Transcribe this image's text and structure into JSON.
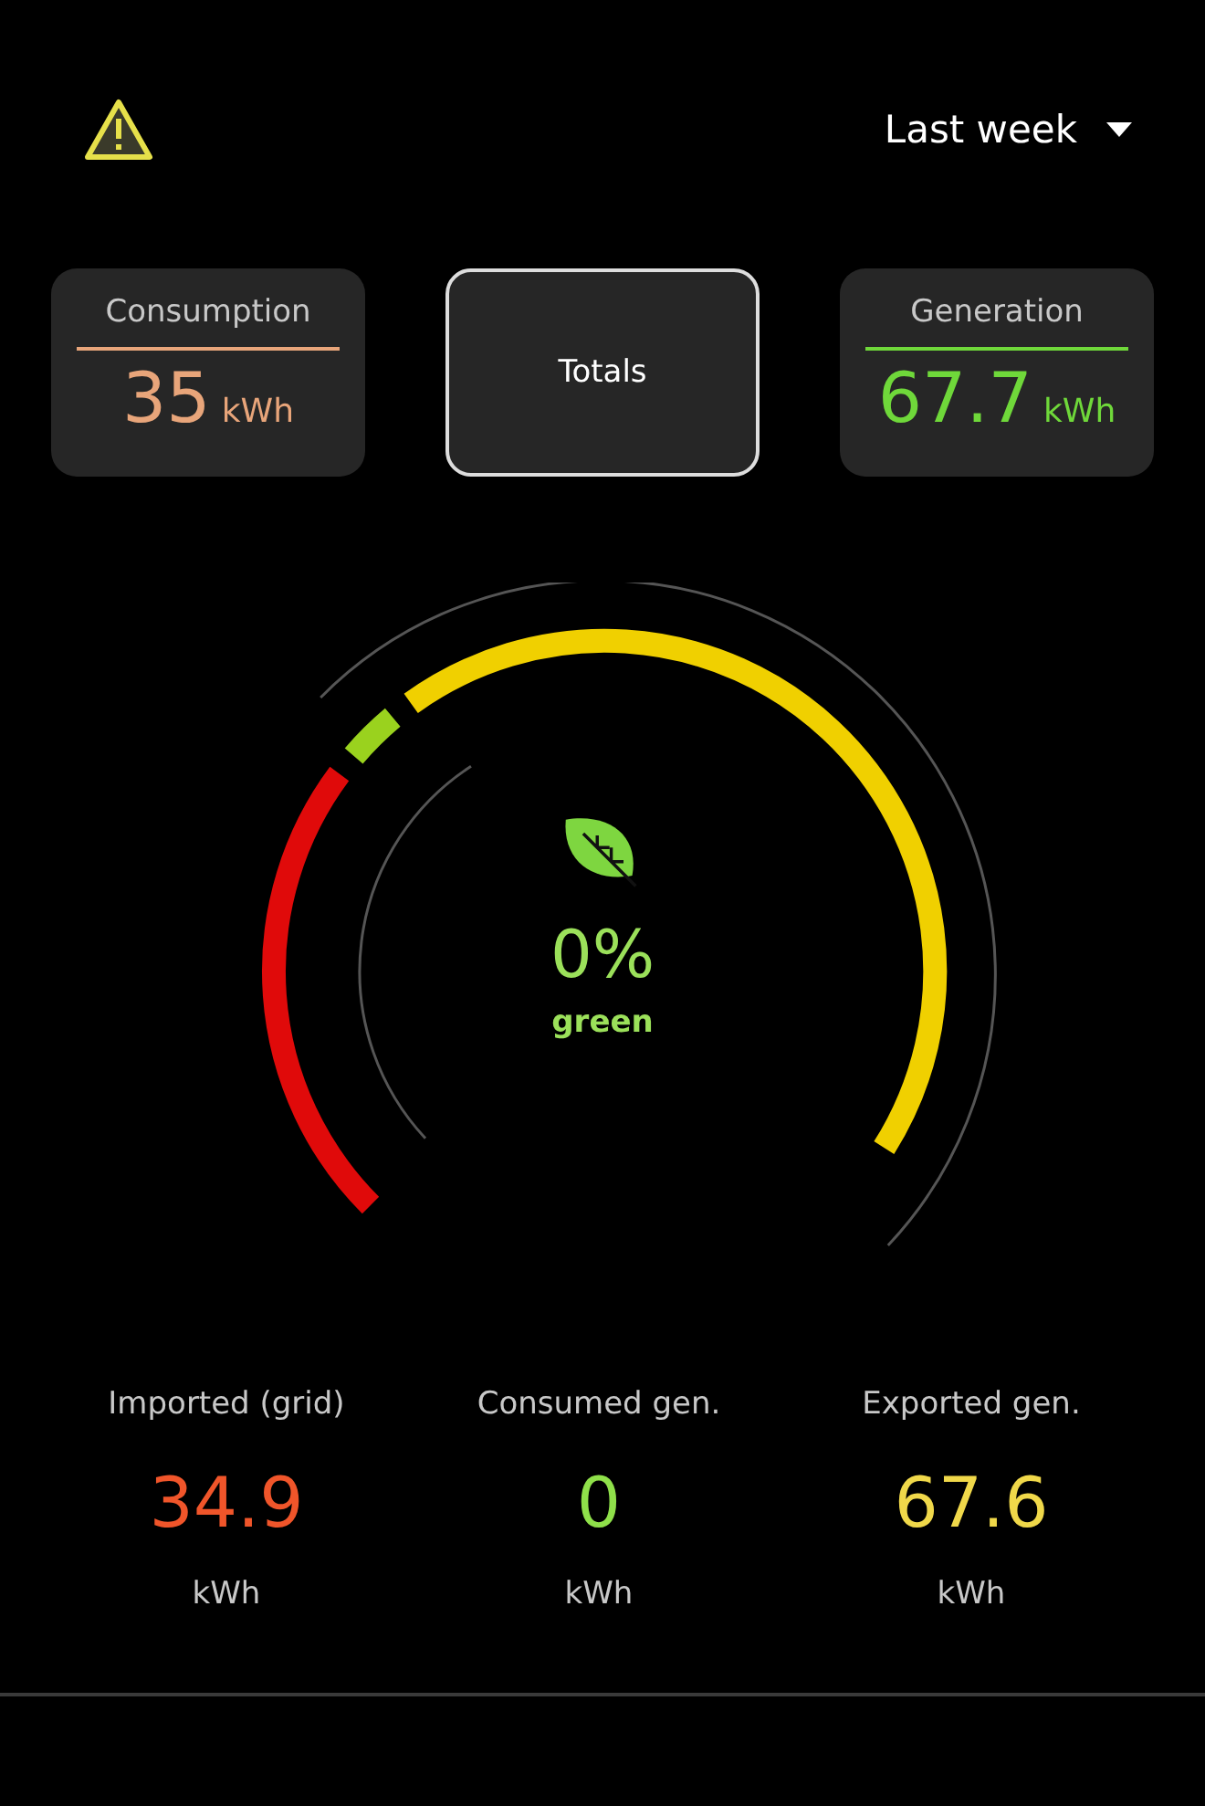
{
  "header": {
    "period": "Last week"
  },
  "cards": [
    {
      "kind": "metric",
      "label": "Consumption",
      "value": "35",
      "unit": "kWh",
      "color": "#e8a57a"
    },
    {
      "kind": "button",
      "label": "Totals"
    },
    {
      "kind": "metric",
      "label": "Generation",
      "value": "67.7",
      "unit": "kWh",
      "color": "#6fd83a"
    }
  ],
  "gauge": {
    "segments": [
      {
        "color": "#e00a0a"
      },
      {
        "color": "#9ad21e"
      },
      {
        "color": "#f0d000"
      }
    ],
    "percent": "0%",
    "caption": "green"
  },
  "stats": [
    {
      "label": "Imported (grid)",
      "value": "34.9",
      "unit": "kWh",
      "color": "#f0552a"
    },
    {
      "label": "Consumed gen.",
      "value": "0",
      "unit": "kWh",
      "color": "#8fe04a"
    },
    {
      "label": "Exported gen.",
      "value": "67.6",
      "unit": "kWh",
      "color": "#f0d84a"
    }
  ]
}
